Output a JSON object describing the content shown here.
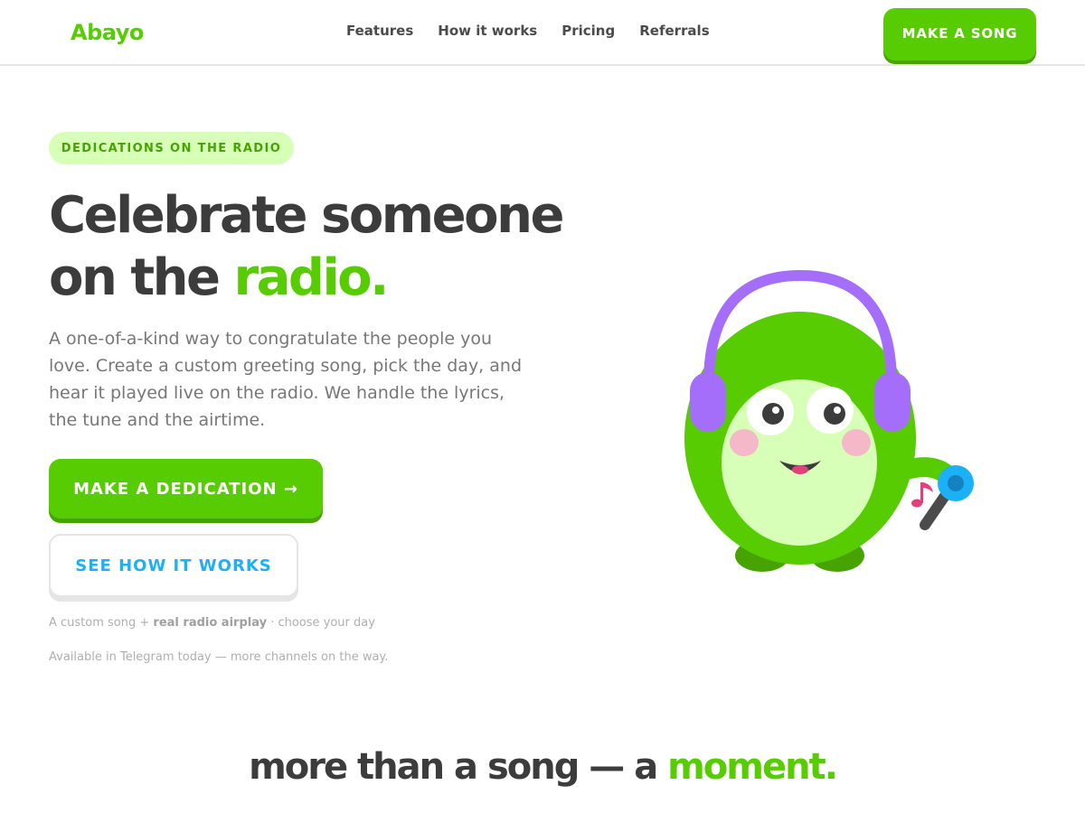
{
  "header": {
    "logo": "Abayo",
    "nav": [
      {
        "label": "Features"
      },
      {
        "label": "How it works"
      },
      {
        "label": "Pricing"
      },
      {
        "label": "Referrals"
      }
    ],
    "cta_label": "MAKE A SONG"
  },
  "hero": {
    "badge": "DEDICATIONS ON THE RADIO",
    "title_line1": "Celebrate someone",
    "title_line2_prefix": "on the ",
    "title_line2_accent": "radio.",
    "lead": "A one-of-a-kind way to congratulate the people you love. Create a custom greeting song, pick the day, and hear it played live on the radio. We handle the lyrics, the tune and the airtime.",
    "primary_button": "MAKE A DEDICATION →",
    "secondary_button": "SEE HOW IT WORKS",
    "meta_prefix": "A custom song + ",
    "meta_bold": "real radio airplay",
    "meta_suffix": " · choose your day",
    "availability": "Available in Telegram today — more channels on the way."
  },
  "section": {
    "title_prefix": "more than a song — a ",
    "title_accent": "moment."
  },
  "colors": {
    "brand_green": "#58cc02",
    "brand_green_dark": "#46a302",
    "badge_bg": "#d7ffb8",
    "link_blue": "#1cb0f6",
    "headphones_purple": "#a46dfa",
    "text_dark": "#3c3c3c",
    "text_muted": "#777777"
  },
  "icons": {
    "mascot": "green-blob-mascot-with-headphones-and-microphone",
    "arrow": "right-arrow-icon",
    "music_note": "music-note-icon"
  }
}
